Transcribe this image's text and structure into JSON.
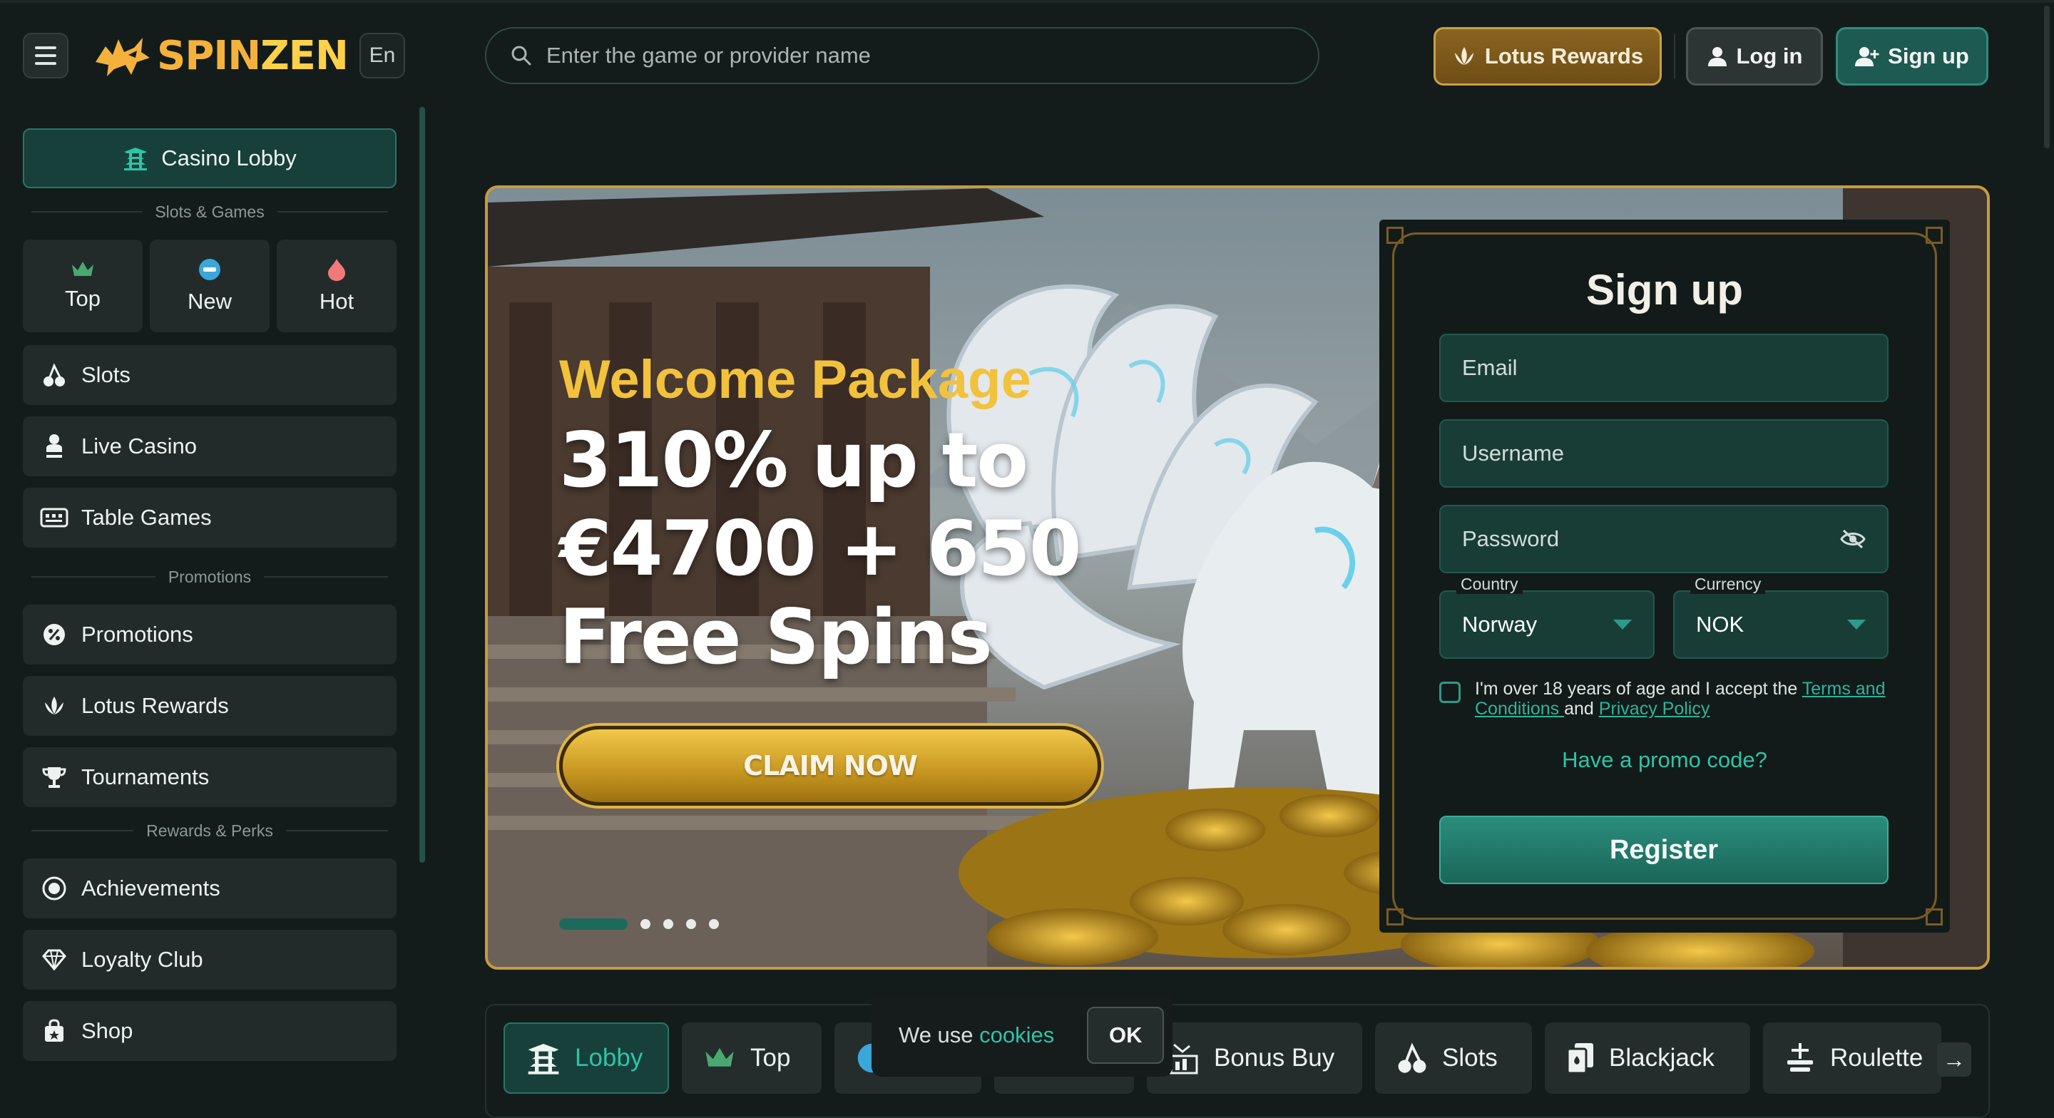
{
  "header": {
    "logo_text_a": "SPIN",
    "logo_text_b": "ZEN",
    "language": "En",
    "search_placeholder": "Enter the game or provider name",
    "lotus_rewards_label": "Lotus Rewards",
    "login_label": "Log in",
    "signup_label": "Sign up"
  },
  "sidebar": {
    "casino_lobby": "Casino Lobby",
    "section_slots_games": "Slots & Games",
    "tiles": [
      {
        "label": "Top",
        "icon": "crown-icon"
      },
      {
        "label": "New",
        "icon": "new-badge-icon"
      },
      {
        "label": "Hot",
        "icon": "flame-icon"
      }
    ],
    "slots": "Slots",
    "live_casino": "Live Casino",
    "table_games": "Table Games",
    "section_promotions": "Promotions",
    "promotions": "Promotions",
    "lotus_rewards": "Lotus Rewards",
    "tournaments": "Tournaments",
    "section_rewards": "Rewards & Perks",
    "achievements": "Achievements",
    "loyalty_club": "Loyalty Club",
    "shop": "Shop"
  },
  "hero": {
    "title": "Welcome Package",
    "line1": "310% up to",
    "line2": "€4700 + 650",
    "line3": "Free Spins",
    "cta": "CLAIM NOW",
    "slide_count": 5,
    "active_slide": 1
  },
  "signup_form": {
    "heading": "Sign up",
    "email_placeholder": "Email",
    "username_placeholder": "Username",
    "password_placeholder": "Password",
    "country_label": "Country",
    "country_value": "Norway",
    "currency_label": "Currency",
    "currency_value": "NOK",
    "terms_text_1": "I'm over 18 years of age and I accept the ",
    "terms_link": "Terms and Conditions ",
    "terms_text_2": "and ",
    "privacy_link": "Privacy Policy",
    "promo_link": "Have a promo code?",
    "register_button": "Register"
  },
  "categories": {
    "lobby": "Lobby",
    "top": "Top",
    "bonus_buy": "Bonus Buy",
    "slots": "Slots",
    "blackjack": "Blackjack",
    "roulette": "Roulette"
  },
  "cookie_banner": {
    "text": "We use ",
    "link": "cookies",
    "ok": "OK"
  },
  "colors": {
    "accent": "#2fc3a8",
    "brand_gold": "#f4b23c",
    "background": "#141c1b"
  }
}
